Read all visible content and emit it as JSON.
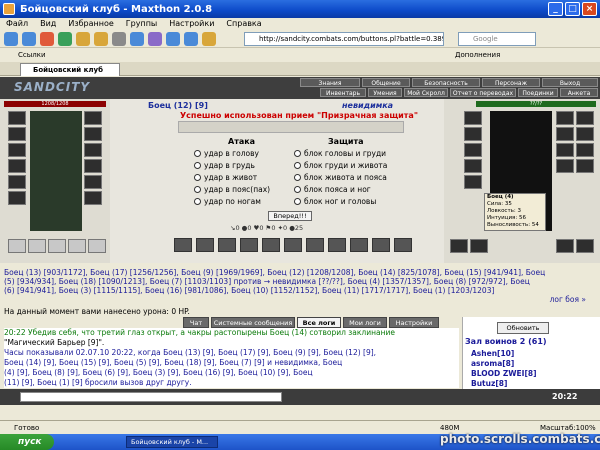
{
  "window": {
    "title": "Бойцовский клуб - Maxthon 2.0.8"
  },
  "menu": [
    "Файл",
    "Вид",
    "Избранное",
    "Группы",
    "Настройки",
    "Справка"
  ],
  "toolbar": {
    "address": "http://sandcity.combats.com/buttons.pl?battle=0.389...",
    "search_placeholder": "Google"
  },
  "links": {
    "label": "Ссылки",
    "extras": "Дополнения"
  },
  "tab": {
    "label": "Бойцовский клуб"
  },
  "game": {
    "logo": "SANDCITY",
    "nav_top": [
      "Знания",
      "Общение",
      "Безопасность",
      "Персонаж",
      "Выход"
    ],
    "nav_bottom": [
      "Инвентарь",
      "Умения",
      "Мой Скролл",
      "Отчет о переводах",
      "Поединки",
      "Анкета"
    ],
    "left_fighter": {
      "name": "Боец (12) [9]",
      "hp": "1208/1208"
    },
    "right_fighter": {
      "name": "невидимка",
      "hp": "??/??"
    },
    "message": "Успешно использован прием \"Призрачная защита\"",
    "attack_title": "Атака",
    "defense_title": "Защита",
    "attacks": [
      "удар в голову",
      "удар в грудь",
      "удар в живот",
      "удар в пояс(пах)",
      "удар по ногам"
    ],
    "defenses": [
      "блок головы и груди",
      "блок груди и живота",
      "блок живота и пояса",
      "блок пояса и ног",
      "блок ног и головы"
    ],
    "go_button": "Вперед!!!",
    "counters": "↘0 ●0 ♥0 ⚑0 ✦0 ●25",
    "stats_popup": [
      "Боец (4)",
      "Сила: 35",
      "Ловкость: 3",
      "Интуиция: 56",
      "Выносливость: 54"
    ]
  },
  "summary": {
    "line1": "Боец (13) [903/1172], Боец (17) [1256/1256], Боец (9) [1969/1969], Боец (12) [1208/1208], Боец (14) [825/1078], Боец (15) [941/941], Боец",
    "line2": "(5) [934/934], Боец (18) [1090/1213], Боец (7) [1103/1103] против → невидимка [??/??], Боец (4) [1357/1357], Боец (8) [972/972], Боец",
    "line3": "(6) [941/941], Боец (3) [1115/1115], Боец (16) [981/1086], Боец (10) [1152/1152], Боец (11) [1717/1717], Боец (1) [1203/1203]",
    "log_link": "лог боя »"
  },
  "damage_line": "На данный момент вами нанесено урона: 0 HP.",
  "chat_tabs": [
    "Чат",
    "Системные сообщения",
    "Все логи",
    "Мои логи",
    "Настройки"
  ],
  "chat": {
    "line1": "20:22 Убедив себя, что третий глаз открыт, а чакры растопырены Боец (14) сотворил заклинание",
    "line2": "\"Магический Барьер [9]\".",
    "line3": "Часы показывали 02.07.10 20:22, когда Боец (13) [9], Боец (17) [9], Боец (9) [9], Боец (12) [9],",
    "line4": "Боец (14) [9], Боец (15) [9], Боец (5) [9], Боец (18) [9], Боец (7) [9] и невидимка, Боец",
    "line5": "(4) [9], Боец (8) [9], Боец (6) [9], Боец (3) [9], Боец (16) [9], Боец (10) [9], Боец",
    "line6": "(11) [9], Боец (1) [9] бросили вызов друг другу."
  },
  "side": {
    "refresh": "Обновить",
    "hall": "Зал воинов 2 (61)",
    "players": [
      "Ashen[10]",
      "asroma[8]",
      "BLOOD ZWEI[8]",
      "Butuz[8]"
    ]
  },
  "clock": "20:22",
  "status": {
    "left": "Готово",
    "right": "480M",
    "zoom": "Масштаб:100%"
  },
  "taskbar": {
    "start": "пуск",
    "task": "Бойцовский клуб - M..."
  },
  "watermark": "photo.scrolls.combats.com"
}
